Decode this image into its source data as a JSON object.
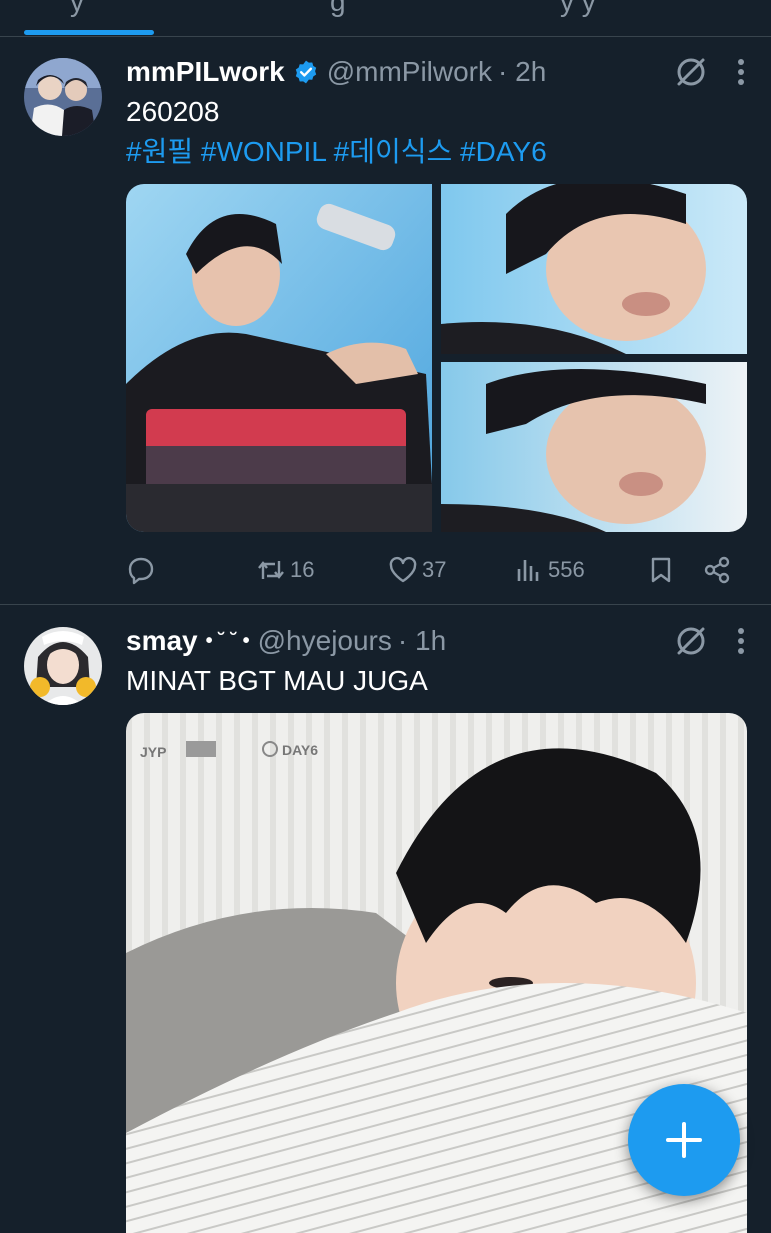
{
  "tabs": {
    "fragment_left": "y",
    "fragment_mid": "g",
    "fragment_right": "y y"
  },
  "tweets": [
    {
      "name": "mmPILwork",
      "verified": true,
      "handle": "@mmPilwork",
      "time": "· 2h",
      "text": "260208",
      "hashtags": "#원필 #WONPIL #데이식스 #DAY6",
      "stats": {
        "retweets": "16",
        "likes": "37",
        "views": "556"
      }
    },
    {
      "name": "smay",
      "name_suffix": "• ˘ ˘ •",
      "handle": "@hyejours",
      "time": "· 1h",
      "text": "MINAT BGT MAU JUGA",
      "media_logos": [
        "JYP",
        "DAY6"
      ]
    }
  ],
  "colors": {
    "background": "#15202b",
    "accent": "#1d9bf0",
    "muted": "#8b98a5",
    "divider": "#38444d"
  },
  "icons": [
    "grok-icon",
    "more-icon",
    "reply-icon",
    "retweet-icon",
    "like-icon",
    "views-icon",
    "bookmark-icon",
    "share-icon",
    "compose-plus-icon",
    "verified-badge-icon"
  ]
}
